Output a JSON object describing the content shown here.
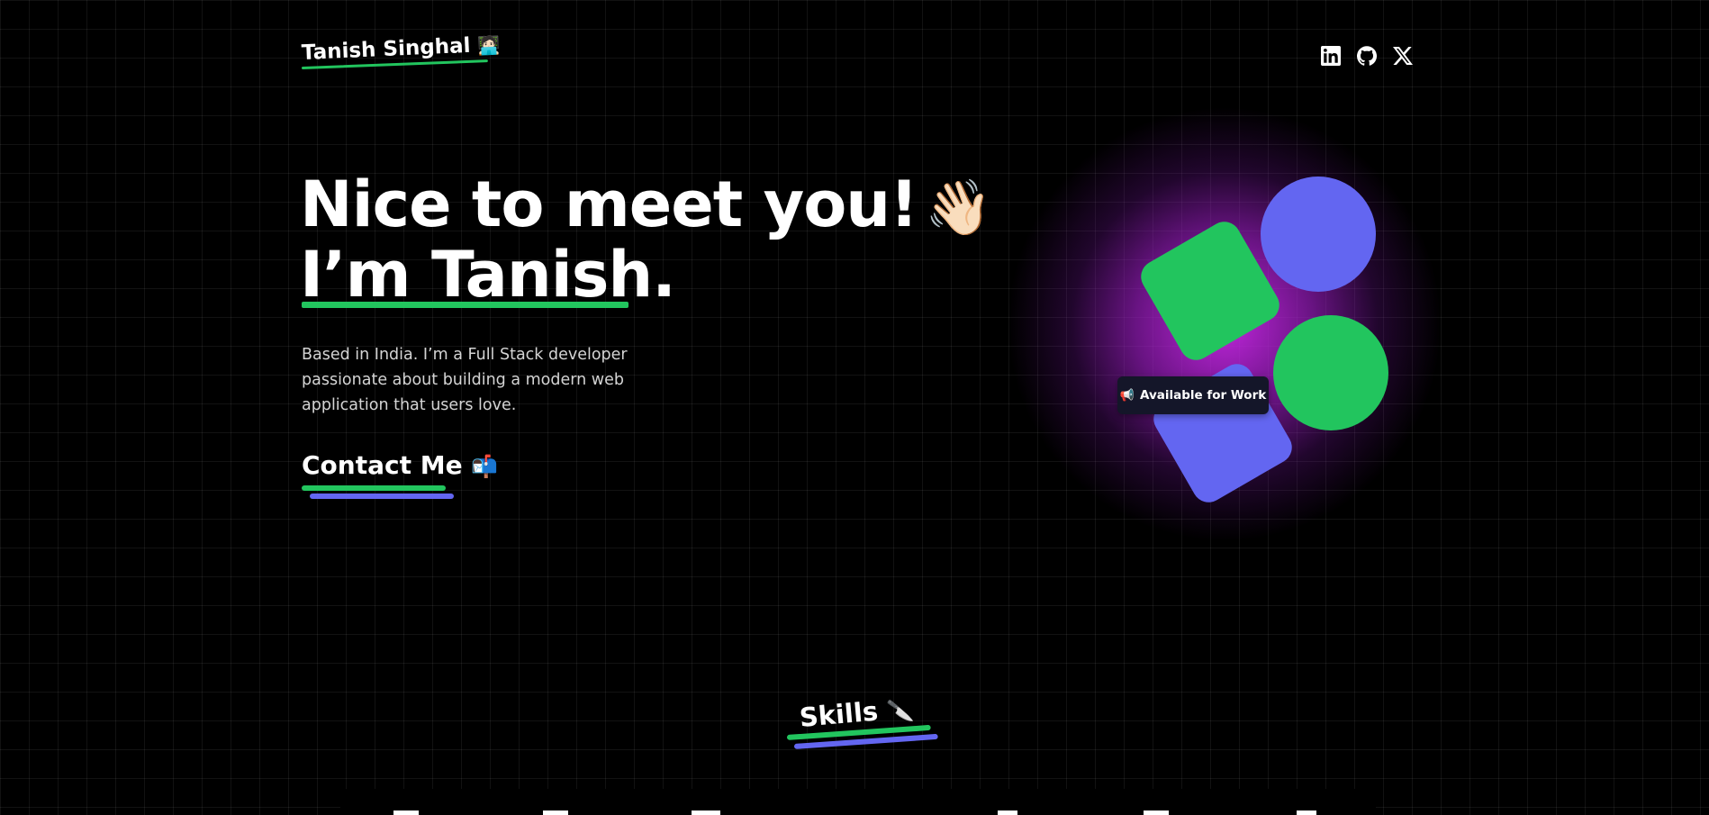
{
  "header": {
    "name": "Tanish Singhal",
    "name_emoji": "🧑🏻‍💻",
    "social": [
      {
        "name": "LinkedIn",
        "icon": "linkedin-icon"
      },
      {
        "name": "GitHub",
        "icon": "github-icon"
      },
      {
        "name": "X",
        "icon": "x-icon"
      }
    ]
  },
  "hero": {
    "line1": "Nice to meet you!",
    "wave_emoji": "👋🏻",
    "line2": "I’m Tanish.",
    "bio": "Based in India. I’m a Full Stack developer passionate about building a modern web application that users love.",
    "contact_label": "Contact Me",
    "contact_emoji": "📬"
  },
  "status": {
    "badge_icon": "📢",
    "badge_text": "Available for Work"
  },
  "skills": {
    "title": "Skills",
    "emoji": "🔪"
  },
  "colors": {
    "accent_green": "#22c55e",
    "accent_purple": "#6366f1",
    "glow": "#c026d3",
    "background": "#000000"
  }
}
